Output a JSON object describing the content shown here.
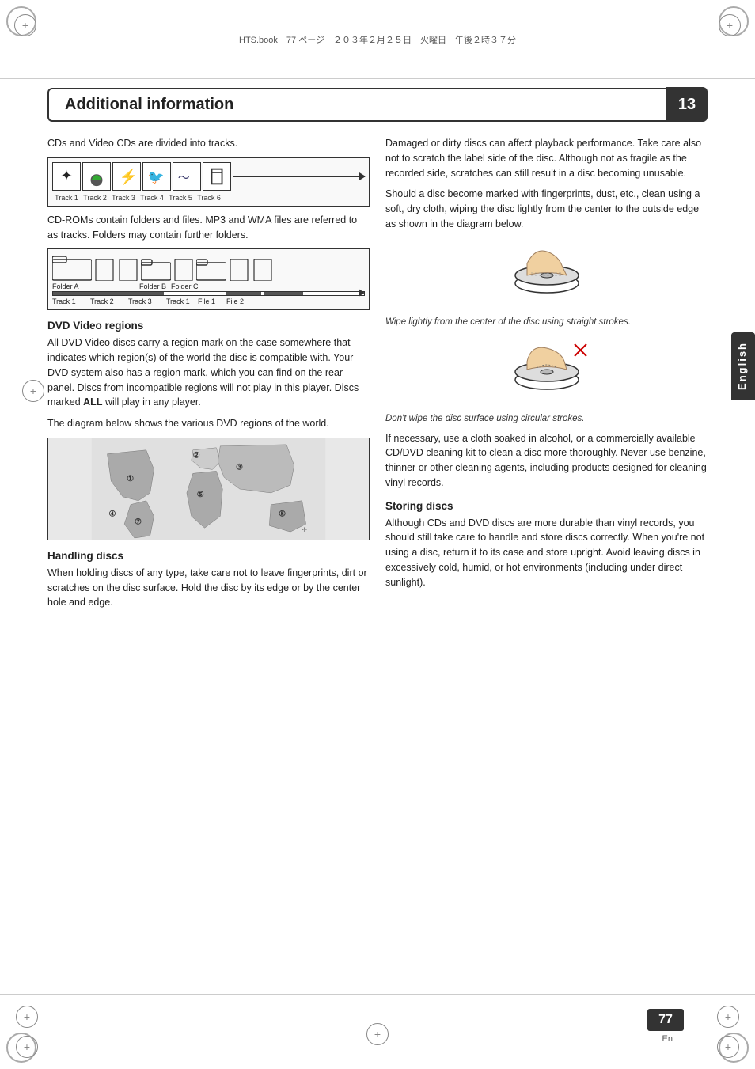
{
  "header": {
    "file_info": "HTS.book　77 ページ　２０３年２月２５日　火曜日　午後２時３７分",
    "title": "Additional information",
    "chapter_number": "13"
  },
  "left_column": {
    "intro_text": "CDs and Video CDs are divided into tracks.",
    "tracks": {
      "labels": [
        "Track 1",
        "Track 2",
        "Track 3",
        "Track 4",
        "Track 5",
        "Track 6"
      ]
    },
    "cdrom_text": "CD-ROMs contain folders and files. MP3 and WMA files are referred to as tracks. Folders may contain further folders.",
    "folders": {
      "folder_labels": [
        "Folder A",
        "",
        "",
        "Folder B",
        "Folder C"
      ],
      "track_labels": [
        "Track 1",
        "Track 2",
        "Track 3",
        "Track 1",
        "File 1",
        "File 2"
      ]
    },
    "dvd_regions": {
      "heading": "DVD Video regions",
      "body": "All DVD Video discs carry a region mark on the case somewhere that indicates which region(s) of the world the disc is compatible with. Your DVD system also has a region mark, which you can find on the rear panel. Discs from incompatible regions will not play in this player. Discs marked ALL will play in any player.",
      "bold_word": "ALL",
      "map_caption": "The diagram below shows the various DVD regions of the world."
    },
    "handling_discs": {
      "heading": "Handling discs",
      "body": "When holding discs of any type, take care not to leave fingerprints, dirt or scratches on the disc surface. Hold the disc by its edge or by the center hole and edge."
    }
  },
  "right_column": {
    "playback_text": "Damaged or dirty discs can affect playback performance. Take care also not to scratch the label side of the disc. Although not as fragile as the recorded side, scratches can still result in a disc becoming unusable.",
    "fingerprint_text": "Should a disc become marked with fingerprints, dust, etc., clean using a soft, dry cloth, wiping the disc lightly from the center to the outside edge as shown in the diagram below.",
    "caption1": "Wipe lightly from the center of the disc using straight strokes.",
    "caption2": "Don't wipe the disc surface using circular strokes.",
    "cleaning_text": "If necessary, use a cloth soaked in alcohol, or a commercially available CD/DVD cleaning kit to clean a disc more thoroughly. Never use benzine, thinner or other cleaning agents, including products designed for cleaning vinyl records.",
    "storing_discs": {
      "heading": "Storing discs",
      "body": "Although CDs and DVD discs are more durable than vinyl records, you should still take care to handle and store discs correctly. When you're not using a disc, return it to its case and store upright. Avoid leaving discs in excessively cold, humid, or hot environments (including under direct sunlight)."
    }
  },
  "english_tab": {
    "label": "English"
  },
  "footer": {
    "page_number": "77",
    "language": "En"
  },
  "icons": {
    "track_icons": [
      "✦",
      "🌳",
      "⚡",
      "🐦",
      "🌊",
      "🏯"
    ]
  }
}
